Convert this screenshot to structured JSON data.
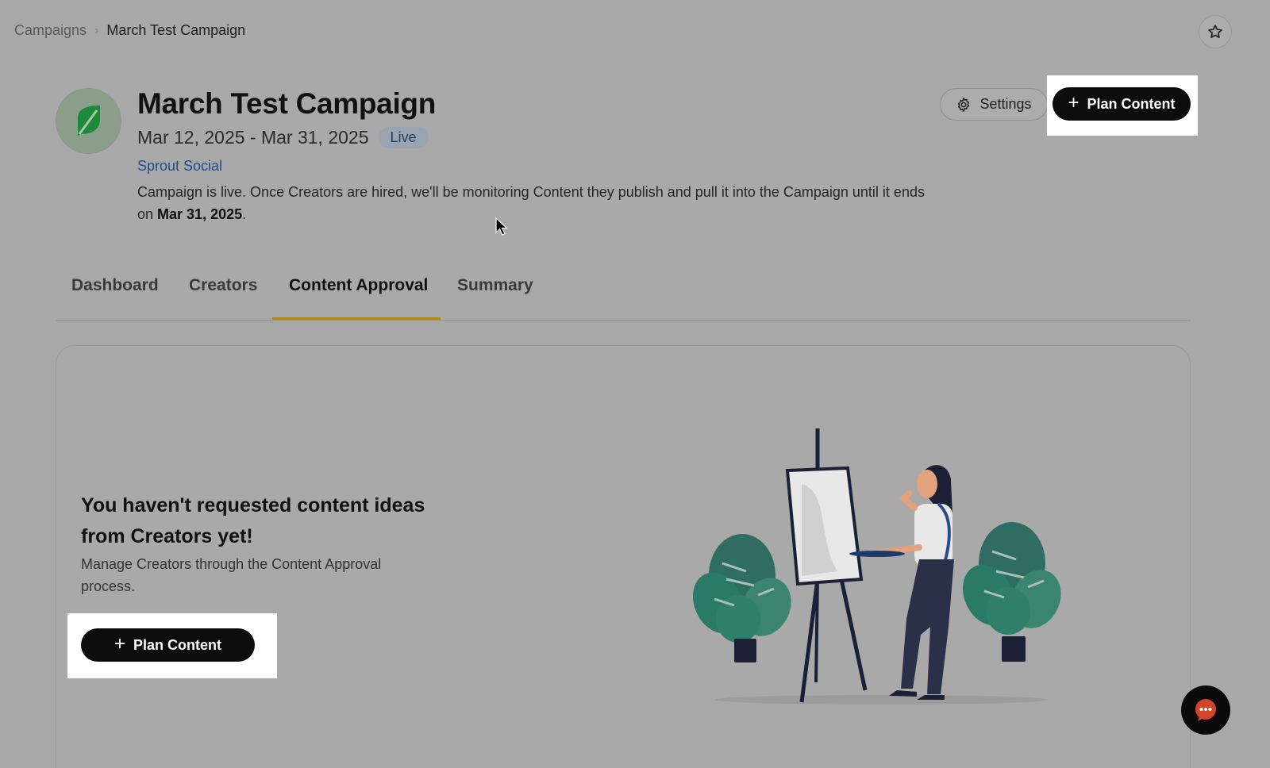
{
  "breadcrumb": {
    "parent": "Campaigns",
    "separator": "›",
    "current": "March Test Campaign"
  },
  "header": {
    "title": "March Test Campaign",
    "date_range": "Mar 12, 2025 - Mar 31, 2025",
    "status": "Live",
    "brand": "Sprout Social",
    "description_prefix": "Campaign is live. Once Creators are hired, we'll be monitoring Content they publish and pull it into the Campaign until it ends on ",
    "description_date": "Mar 31, 2025",
    "description_suffix": ".",
    "settings_label": "Settings",
    "plan_content_label": "Plan Content"
  },
  "tabs": [
    {
      "label": "Dashboard",
      "active": false
    },
    {
      "label": "Creators",
      "active": false
    },
    {
      "label": "Content Approval",
      "active": true
    },
    {
      "label": "Summary",
      "active": false
    }
  ],
  "empty_state": {
    "title": "You haven't requested content ideas from Creators yet!",
    "description": "Manage Creators through the Content Approval process.",
    "button_label": "Plan Content"
  },
  "colors": {
    "background": "#a9a9a9",
    "primary_button": "#0c0c0c",
    "tab_accent": "#b0861a",
    "link": "#1f4a92",
    "brand_logo": "#1c8a3a"
  },
  "icons": {
    "star": "star-icon",
    "gear": "gear-icon",
    "plus": "plus-icon",
    "chat": "chat-icon"
  }
}
